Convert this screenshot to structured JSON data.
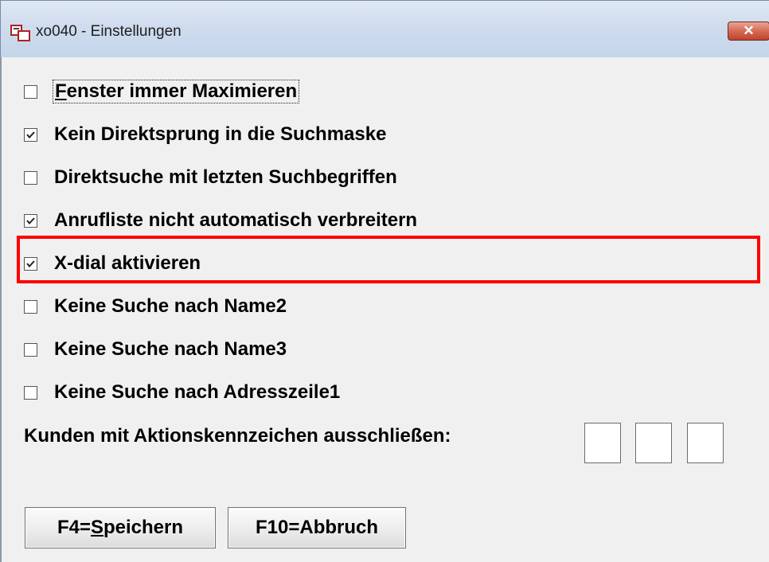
{
  "window": {
    "title": "xo040 - Einstellungen",
    "close_icon": "close-icon"
  },
  "options": [
    {
      "first": "F",
      "rest": "enster immer Maximieren",
      "checked": false,
      "focused": true
    },
    {
      "label": "Kein Direktsprung in die Suchmaske",
      "checked": true
    },
    {
      "label": "Direktsuche mit letzten Suchbegriffen",
      "checked": false
    },
    {
      "label": "Anrufliste nicht automatisch verbreitern",
      "checked": true
    },
    {
      "label": "X-dial aktivieren",
      "checked": true,
      "highlighted": true
    },
    {
      "label": "Keine Suche nach Name2",
      "checked": false
    },
    {
      "label": "Keine Suche nach Name3",
      "checked": false
    },
    {
      "label": "Keine Suche nach Adresszeile1",
      "checked": false
    }
  ],
  "kunden": {
    "label": "Kunden mit Aktionskennzeichen ausschließen:",
    "codes": [
      "",
      "",
      ""
    ]
  },
  "buttons": {
    "save_prefix": "F4=",
    "save_mnemonic": "S",
    "save_suffix": "peichern",
    "cancel": "F10=Abbruch"
  },
  "colors": {
    "highlight": "#ff0000",
    "window_bg": "#f0f0f0",
    "close_button": "#c94a33"
  }
}
